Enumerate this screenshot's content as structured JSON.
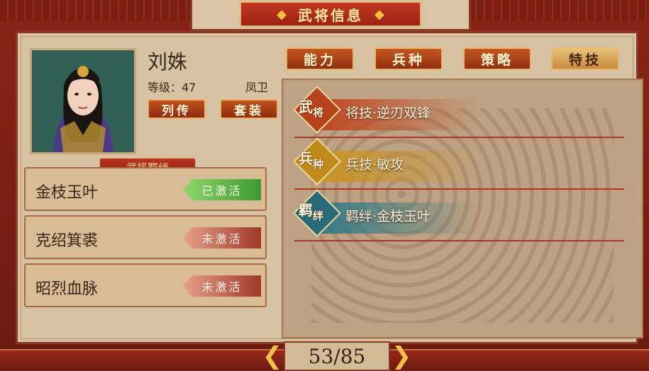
{
  "title": "武将信息",
  "general": {
    "name": "刘姝",
    "level": "等级：47",
    "rank": "凤卫",
    "bio_button": "列传",
    "set_button": "套装"
  },
  "bonds": {
    "header": "武将羁绊",
    "items": [
      {
        "label": "金枝玉叶",
        "status": "已激活",
        "active": true
      },
      {
        "label": "克绍箕裘",
        "status": "未激活",
        "active": false
      },
      {
        "label": "昭烈血脉",
        "status": "未激活",
        "active": false
      }
    ]
  },
  "tabs": [
    "能力",
    "兵种",
    "策略",
    "特技"
  ],
  "active_tab": "特技",
  "skills": [
    {
      "badge_main": "武",
      "badge_sub": "将",
      "name": "将技·逆刃双锋",
      "color": "#c0441e"
    },
    {
      "badge_main": "兵",
      "badge_sub": "种",
      "name": "兵技·敏攻",
      "color": "#c99220"
    },
    {
      "badge_main": "羁",
      "badge_sub": "绊",
      "name": "羁绊·金枝玉叶",
      "color": "#2f7a86"
    }
  ],
  "pager": {
    "text": "53/85",
    "prev": "❮",
    "next": "❯"
  },
  "colors": {
    "accent": "#c23620",
    "active_green": "#3d9a30",
    "inactive_red": "#a0382a"
  }
}
